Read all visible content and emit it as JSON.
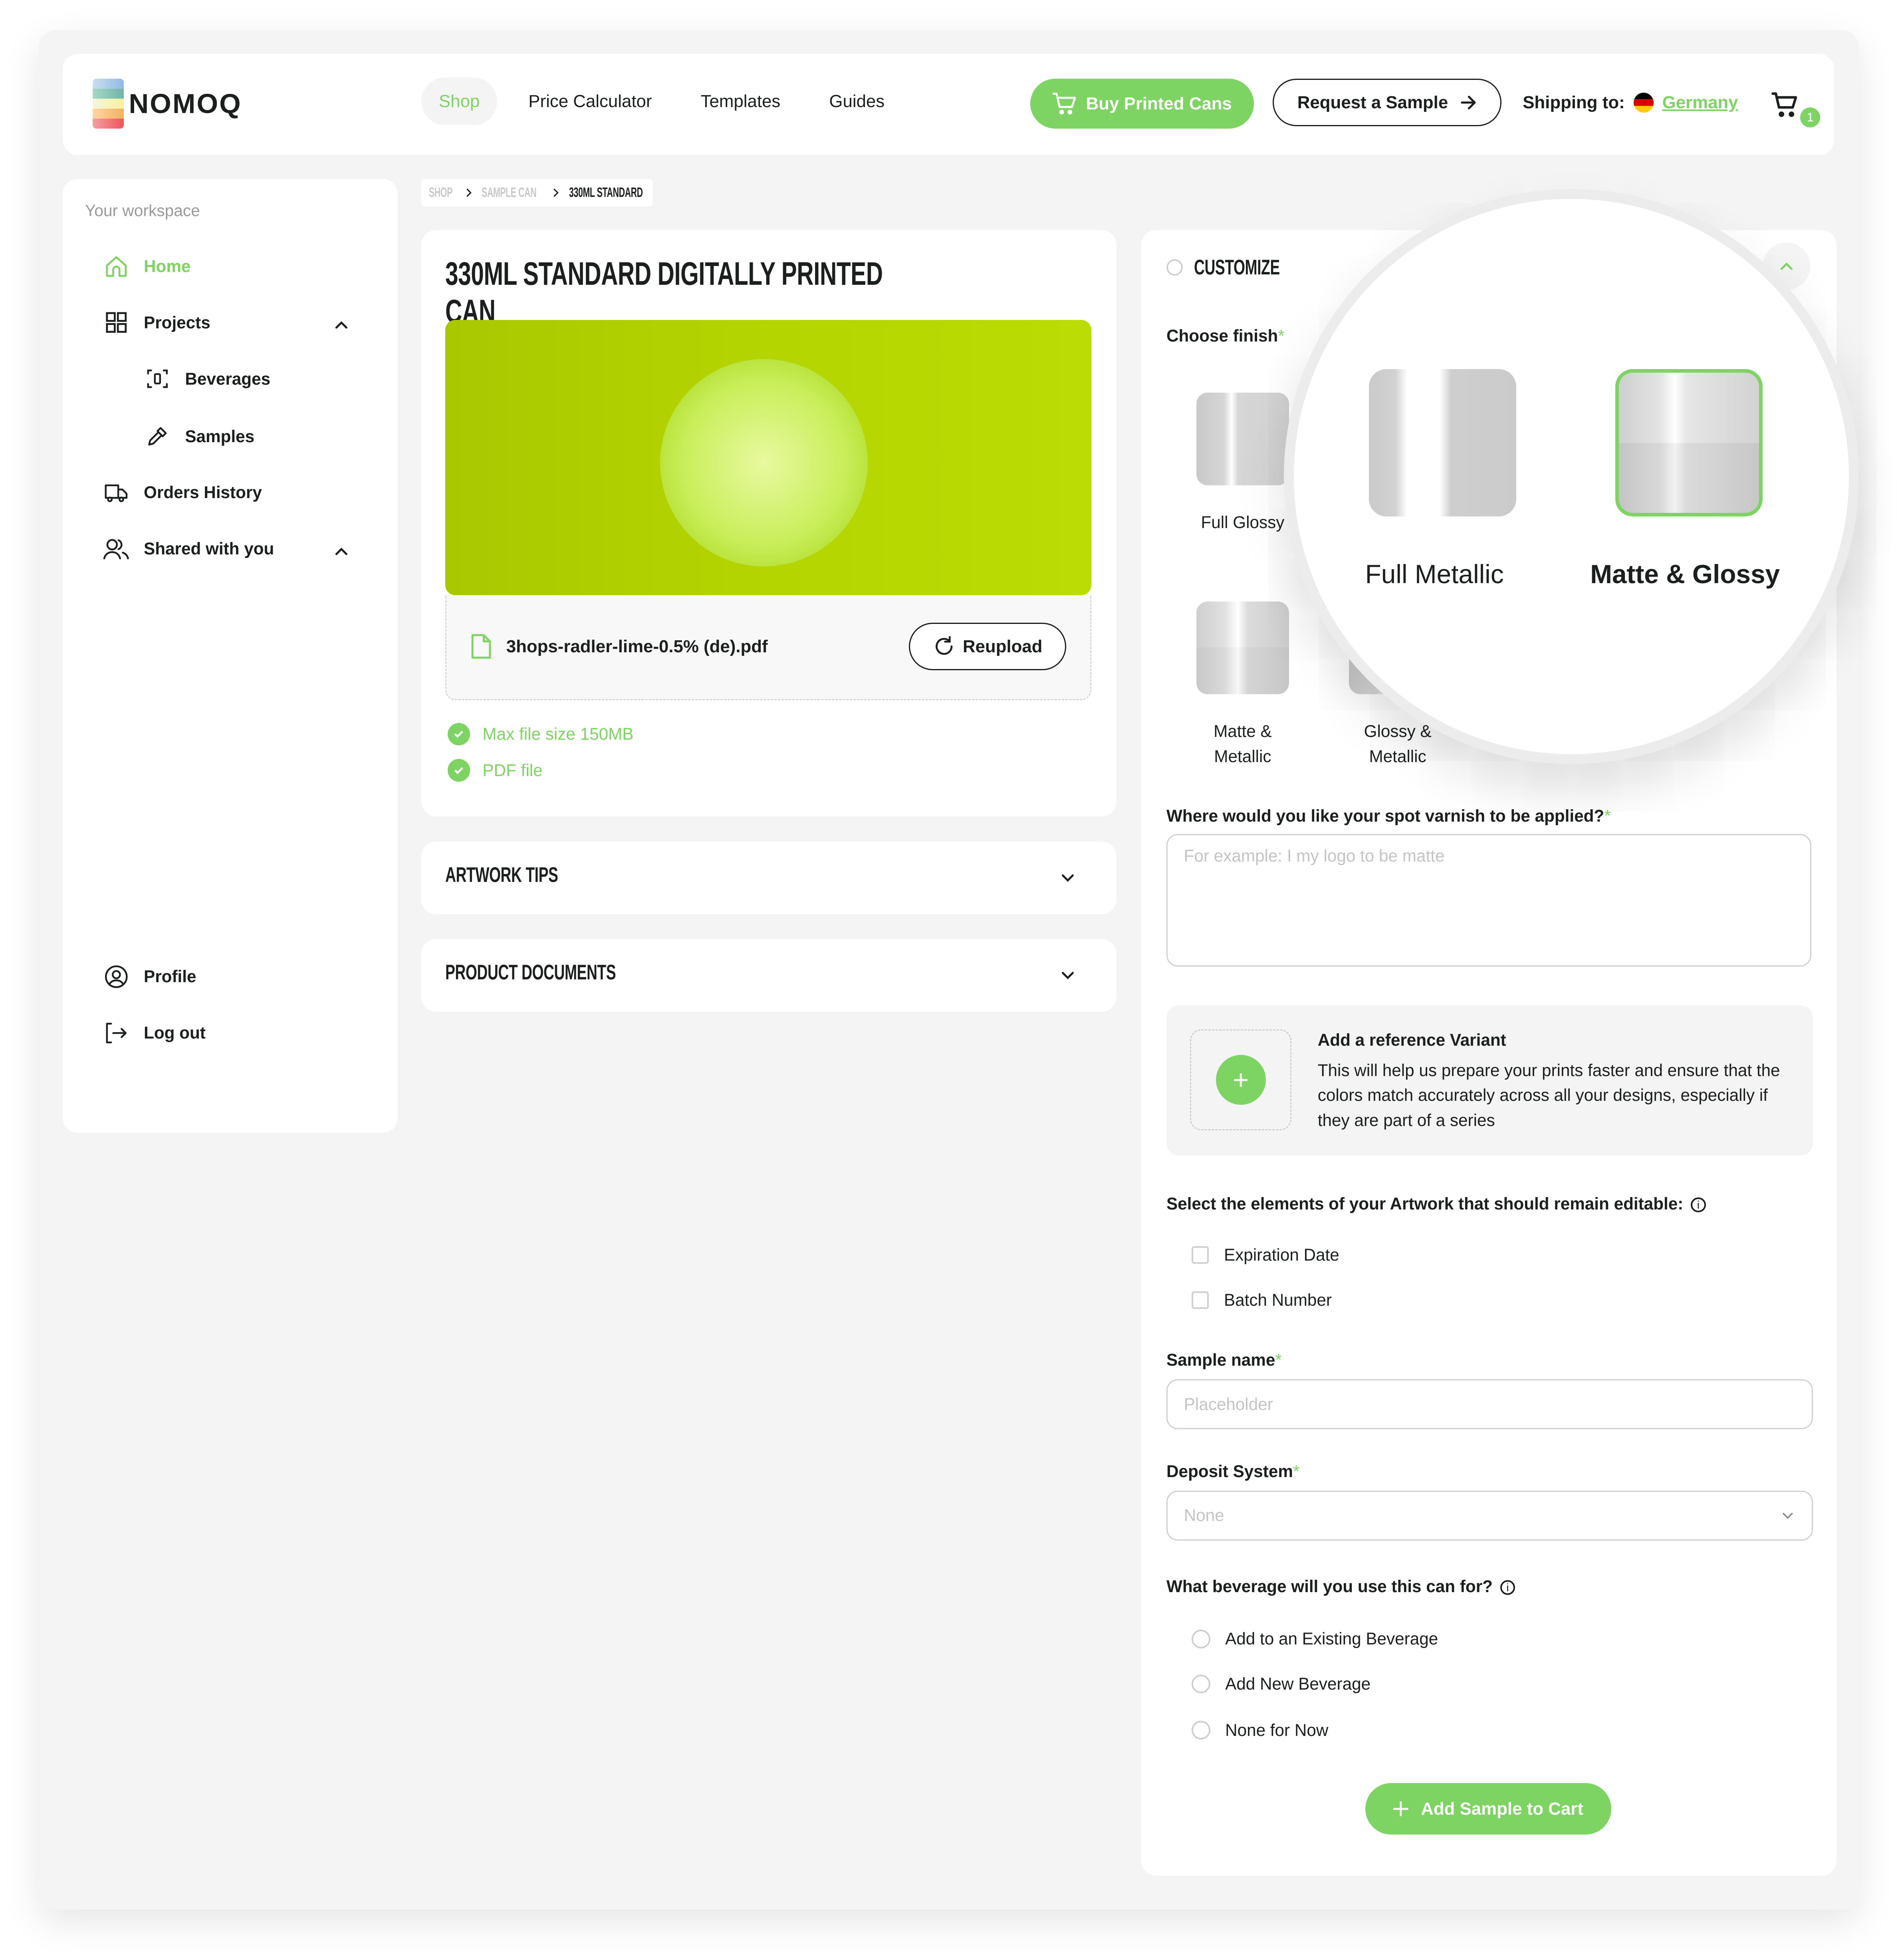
{
  "brand": {
    "name": "NOMOQ",
    "logo_colors": [
      "#a7c8ea",
      "#84c3b0",
      "#f6f1b5",
      "#f8c57c",
      "#ee6d74"
    ]
  },
  "colors": {
    "accent": "#7ed463",
    "text": "#1b1f1d",
    "muted": "#9a9a9a",
    "background": "#f4f4f4"
  },
  "header": {
    "nav": [
      {
        "label": "Shop",
        "active": true
      },
      {
        "label": "Price Calculator",
        "active": false
      },
      {
        "label": "Templates",
        "active": false
      },
      {
        "label": "Guides",
        "active": false
      }
    ],
    "buy_button": {
      "label": "Buy Printed Cans",
      "icon": "cart-icon"
    },
    "sample_button": {
      "label": "Request a Sample",
      "icon": "arrow-right-icon"
    },
    "shipping_label": "Shipping to:",
    "shipping_country": "Germany",
    "cart_count": "1"
  },
  "sidebar": {
    "section_label": "Your workspace",
    "items": [
      {
        "label": "Home",
        "icon": "home-icon",
        "active": true
      },
      {
        "label": "Projects",
        "icon": "grid-icon",
        "expanded": true
      },
      {
        "label": "Beverages",
        "icon": "can-scan-icon",
        "sub": true
      },
      {
        "label": "Samples",
        "icon": "pipette-icon",
        "sub": true
      },
      {
        "label": "Orders History",
        "icon": "truck-icon"
      },
      {
        "label": "Shared with you",
        "icon": "users-icon",
        "expanded": true
      }
    ],
    "bottom_items": [
      {
        "label": "Profile",
        "icon": "user-circle-icon"
      },
      {
        "label": "Log out",
        "icon": "logout-icon"
      }
    ]
  },
  "breadcrumb": {
    "items": [
      "SHOP",
      "SAMPLE CAN",
      "330ML STANDARD"
    ]
  },
  "product": {
    "title": "330ML STANDARD DIGITALLY PRINTED CAN",
    "file_name": "3hops-radler-lime-0.5% (de).pdf",
    "reupload_label": "Reupload",
    "requirements": [
      "Max file size 150MB",
      "PDF file"
    ]
  },
  "accordions": [
    {
      "title": "ARTWORK TIPS"
    },
    {
      "title": "PRODUCT DOCUMENTS"
    }
  ],
  "customize": {
    "title": "CUSTOMIZE",
    "finish_label": "Choose finish",
    "finishes": [
      {
        "label": "Full Glossy",
        "selected": false
      },
      {
        "label": "Full Metallic",
        "selected": false
      },
      {
        "label": "Matte & Glossy",
        "selected": true
      },
      {
        "label": "Matte & Metallic",
        "selected": false
      },
      {
        "label": "Glossy & Metallic",
        "selected": false
      }
    ],
    "magnifier": {
      "left_label": "Full Metallic",
      "right_label": "Matte & Glossy"
    },
    "varnish_label": "Where would you like your spot varnish to be applied?",
    "varnish_placeholder": "For example: I my logo to be matte",
    "reference": {
      "title": "Add a reference Variant",
      "description": "This will help us prepare your prints faster and ensure that the colors match accurately across all your designs, especially if they are part of a series"
    },
    "editable_label": "Select the elements of your Artwork that should remain editable:",
    "editable_options": [
      {
        "label": "Expiration Date",
        "checked": false
      },
      {
        "label": "Batch Number",
        "checked": false
      }
    ],
    "sample_name_label": "Sample name",
    "sample_name_placeholder": "Placeholder",
    "deposit_label": "Deposit System",
    "deposit_value": "None",
    "beverage_label": "What beverage will you use this can for?",
    "beverage_options": [
      {
        "label": "Add to an Existing Beverage",
        "selected": false
      },
      {
        "label": "Add New Beverage",
        "selected": false
      },
      {
        "label": "None for Now",
        "selected": false
      }
    ],
    "add_to_cart_label": "Add Sample to Cart",
    "required_mark": "*"
  }
}
